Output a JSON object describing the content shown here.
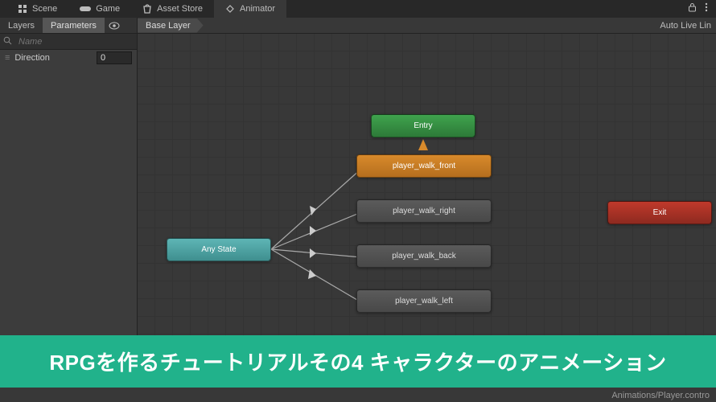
{
  "tabs": {
    "scene": "Scene",
    "game": "Game",
    "asset_store": "Asset Store",
    "animator": "Animator"
  },
  "side": {
    "layers_tab": "Layers",
    "params_tab": "Parameters",
    "search_placeholder": "Name",
    "param": {
      "name": "Direction",
      "value": "0"
    }
  },
  "breadcrumb": "Base Layer",
  "auto_live": "Auto Live Lin",
  "nodes": {
    "entry": "Entry",
    "default": "player_walk_front",
    "right": "player_walk_right",
    "back": "player_walk_back",
    "left": "player_walk_left",
    "any": "Any State",
    "exit": "Exit"
  },
  "footer_path": "Animations/Player.contro",
  "banner": "RPGを作るチュートリアルその4 キャラクターのアニメーション",
  "colors": {
    "accent_banner": "#21b28b",
    "entry": "#3fa34d",
    "default": "#d88a2b",
    "exit": "#c0392b",
    "any": "#5eb5b5"
  }
}
